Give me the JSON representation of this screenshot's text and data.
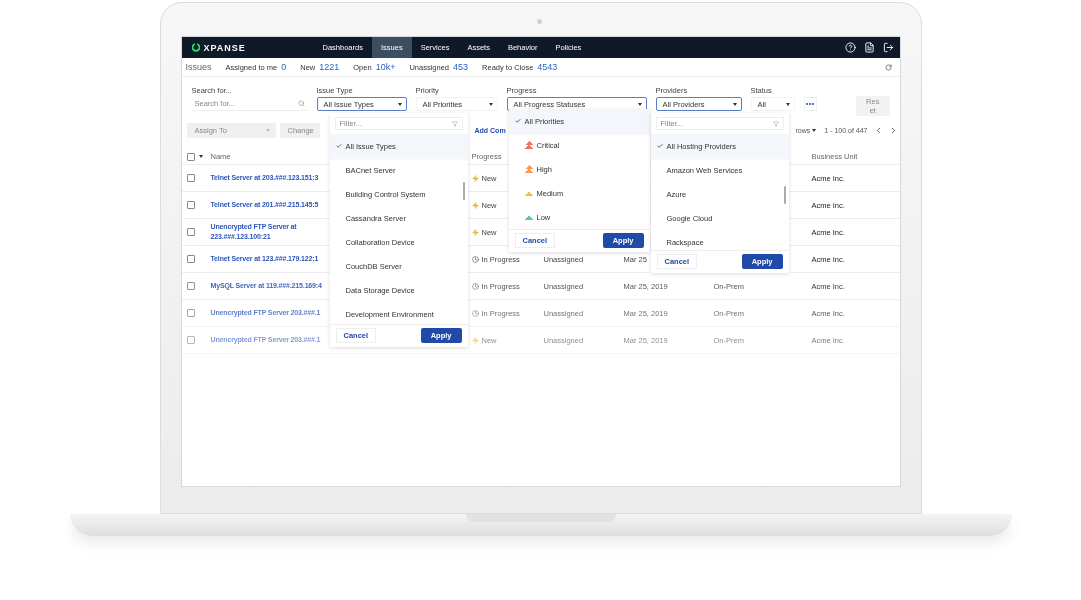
{
  "nav": {
    "logo": "XPANSE",
    "items": [
      {
        "label": "Dashboards",
        "selected": false
      },
      {
        "label": "Issues",
        "selected": true
      },
      {
        "label": "Services",
        "selected": false
      },
      {
        "label": "Assets",
        "selected": false
      },
      {
        "label": "Behavior",
        "selected": false
      },
      {
        "label": "Policies",
        "selected": false
      }
    ]
  },
  "summary": {
    "title": "Issues",
    "stats": [
      {
        "label": "Assigned to me",
        "value": "0"
      },
      {
        "label": "New",
        "value": "1221"
      },
      {
        "label": "Open",
        "value": "10k+"
      },
      {
        "label": "Unassigned",
        "value": "453"
      },
      {
        "label": "Ready to Close",
        "value": "4543"
      }
    ]
  },
  "filters": {
    "search": {
      "label": "Search for...",
      "placeholder": "Search for..."
    },
    "selects": [
      {
        "label": "Issue Type",
        "value": "All Issue Types",
        "focused": true
      },
      {
        "label": "Priority",
        "value": "All Priorities",
        "focused": false
      },
      {
        "label": "Progress",
        "value": "All Progress Statuses",
        "focused": true
      },
      {
        "label": "Providers",
        "value": "All Providers",
        "focused": true
      },
      {
        "label": "Status",
        "value": "All",
        "focused": false
      }
    ],
    "reset": {
      "label": "Reset",
      "disabled": true
    }
  },
  "actions": {
    "buttons": [
      {
        "label": "Assign To",
        "disabled": true
      },
      {
        "label": "Change",
        "disabled": true
      }
    ],
    "link": "Add Com",
    "rows_menu": "rows",
    "range": "1 - 100 of 447"
  },
  "table": {
    "select_all": {
      "checked": false
    },
    "header": {
      "name": "Name",
      "progress": "Progress",
      "business_unit": "Business Unit"
    },
    "rows": [
      {
        "checked": false,
        "name": "Telnet Server at 203.###.123.151:3",
        "progress": {
          "label": "New",
          "kind": "new"
        },
        "business_unit": "Acme Inc."
      },
      {
        "checked": false,
        "name": "Telnet Server at 201.###.215.145:5",
        "progress": {
          "label": "New",
          "kind": "new"
        },
        "business_unit": "Acme Inc."
      },
      {
        "checked": false,
        "name": "Unencrypted FTP Server at 223.###.123.100:21",
        "progress": {
          "label": "New",
          "kind": "new"
        },
        "business_unit": "Acme Inc."
      },
      {
        "checked": false,
        "name": "Telnet Server at 123.###.179.122:1",
        "progress": {
          "label": "In Progress",
          "kind": "in_progress"
        },
        "assignee": "Unassigned",
        "date": "Mar 25",
        "business_unit": "Acme Inc."
      },
      {
        "checked": false,
        "name": "MySQL Server at 119.###.215.169:4",
        "progress": {
          "label": "In Progress",
          "kind": "in_progress"
        },
        "assignee": "Unassigned",
        "date": "Mar 25, 2019",
        "hosting": "On-Prem",
        "business_unit": "Acme Inc."
      },
      {
        "checked": false,
        "name": "Unencrypted FTP Server 203.###.1",
        "progress": {
          "label": "In Progress",
          "kind": "in_progress"
        },
        "assignee": "Unassigned",
        "date": "Mar 25, 2019",
        "hosting": "On-Prem",
        "business_unit": "Acme Inc."
      },
      {
        "checked": false,
        "name": "Unencrypted FTP Server 203.###.1",
        "progress": {
          "label": "New",
          "kind": "new"
        },
        "assignee": "Unassigned",
        "date": "Mar 25, 2019",
        "hosting": "On-Prem",
        "business_unit": "Acme Inc."
      }
    ]
  },
  "dropdowns": [
    {
      "kind": "issue_type",
      "filter_placeholder": "Filter...",
      "items": [
        {
          "label": "All Issue Types",
          "selected": true
        },
        {
          "label": "BACnet Server",
          "selected": false
        },
        {
          "label": "Building Control System",
          "selected": false
        },
        {
          "label": "Cassandra Server",
          "selected": false
        },
        {
          "label": "Collaboration Device",
          "selected": false
        },
        {
          "label": "CouchDB Server",
          "selected": false
        },
        {
          "label": "Data Storage Device",
          "selected": false
        },
        {
          "label": "Development Environment",
          "selected": false
        }
      ],
      "cancel": "Cancel",
      "apply": "Apply"
    },
    {
      "kind": "priority",
      "items": [
        {
          "label": "All Priorities",
          "selected": true
        },
        {
          "label": "Critical",
          "selected": false,
          "color": "#f0706a",
          "kind": "double"
        },
        {
          "label": "High",
          "selected": false,
          "color": "#f59a5b",
          "kind": "double"
        },
        {
          "label": "Medium",
          "selected": false,
          "color": "#f5c342",
          "kind": "single"
        },
        {
          "label": "Low",
          "selected": false,
          "color": "#5cc7a0",
          "kind": "single"
        }
      ],
      "cancel": "Cancel",
      "apply": "Apply"
    },
    {
      "kind": "providers",
      "filter_placeholder": "Filter...",
      "items": [
        {
          "label": "All Hosting Providers",
          "selected": true
        },
        {
          "label": "Amazon Web Services",
          "selected": false
        },
        {
          "label": "Azure",
          "selected": false
        },
        {
          "label": "Google Cloud",
          "selected": false
        },
        {
          "label": "Rackspace",
          "selected": false
        }
      ],
      "cancel": "Cancel",
      "apply": "Apply"
    }
  ]
}
